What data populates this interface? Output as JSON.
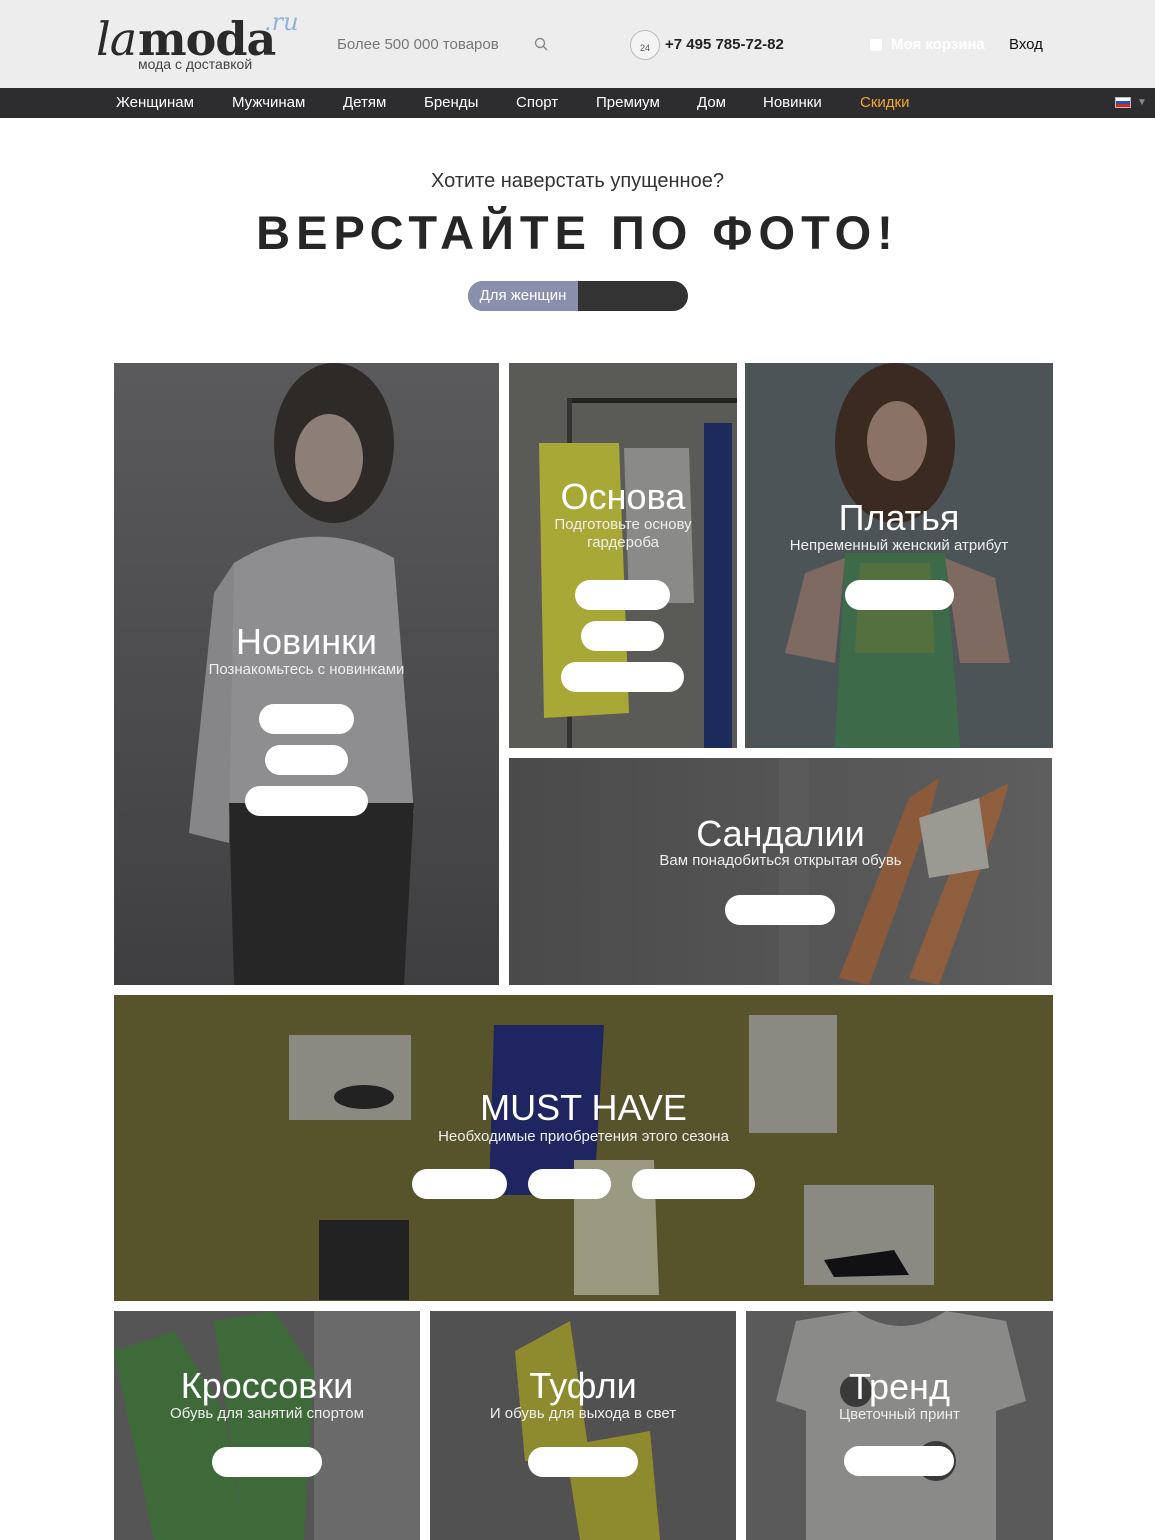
{
  "header": {
    "logo": {
      "main": "lamoda",
      "part1": "la",
      "part2": "moda",
      "suffix": ".ru",
      "tagline": "мода с доставкой"
    },
    "search_text": "Более 500 000 товаров",
    "phone_icon_text": "24",
    "phone": "+7 495 785-72-82",
    "cart": "Моя корзина",
    "login": "Вход"
  },
  "nav": {
    "items": [
      "Женщинам",
      "Мужчинам",
      "Детям",
      "Бренды",
      "Спорт",
      "Премиум",
      "Дом",
      "Новинки",
      "Скидки"
    ],
    "accent_color": "#f4a52b"
  },
  "hero": {
    "subtitle": "Хотите наверстать упущенное?",
    "title": "ВЕРСТАЙТЕ ПО ФОТО!",
    "toggle_label": "Для женщин"
  },
  "tiles": {
    "new": {
      "title": "Новинки",
      "subtitle": "Познакомьтесь с новинками"
    },
    "basics": {
      "title": "Основа",
      "subtitle": "Подготовьте основу гардероба"
    },
    "dresses": {
      "title": "Платья",
      "subtitle": "Непременный женский атрибут"
    },
    "sandals": {
      "title": "Сандалии",
      "subtitle": "Вам понадобиться открытая обувь"
    },
    "musthave": {
      "title": "MUST HAVE",
      "subtitle": "Необходимые приобретения этого сезона"
    },
    "sneakers": {
      "title": "Кроссовки",
      "subtitle": "Обувь для занятий спортом"
    },
    "shoes": {
      "title": "Туфли",
      "subtitle": "И обувь для выхода в свет"
    },
    "trend": {
      "title": "Тренд",
      "subtitle": "Цветочный принт"
    }
  }
}
